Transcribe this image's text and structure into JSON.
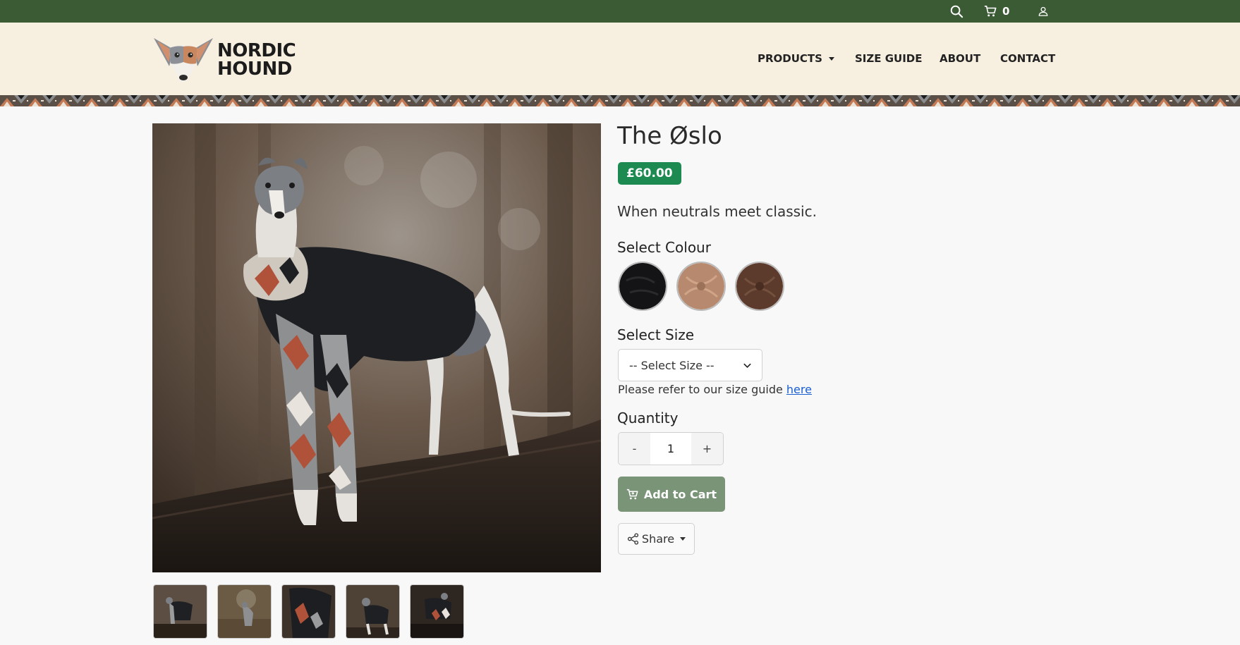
{
  "topbar": {
    "icons": [
      "search-icon",
      "cart-icon",
      "user-icon"
    ],
    "cart_count": "0"
  },
  "header": {
    "logo_line1": "NORDIC",
    "logo_line2": "HOUND",
    "nav": [
      "PRODUCTS",
      "SIZE GUIDE",
      "ABOUT",
      "CONTACT"
    ]
  },
  "product": {
    "title": "The Øslo",
    "price": "£60.00",
    "tagline": "When neutrals meet classic.",
    "colour_label": "Select Colour",
    "colours": [
      {
        "name": "black",
        "hex": "#141416"
      },
      {
        "name": "tan",
        "hex": "#b78a6f"
      },
      {
        "name": "brown",
        "hex": "#5d3b2c"
      }
    ],
    "size_label": "Select Size",
    "size_selected": "-- Select Size --",
    "size_note": "Please refer to our size guide",
    "size_link": "here",
    "quantity_label": "Quantity",
    "qty_minus": "-",
    "qty_value": "1",
    "qty_plus": "+",
    "add_to_cart": "Add to Cart",
    "share": "Share",
    "thumbnail_count": 5
  },
  "colors": {
    "topbar": "#3b5b35",
    "header_bg": "#f7efe0",
    "price_badge": "#1d8a52",
    "add_to_cart": "#7a9478",
    "link": "#1a5fd0"
  }
}
